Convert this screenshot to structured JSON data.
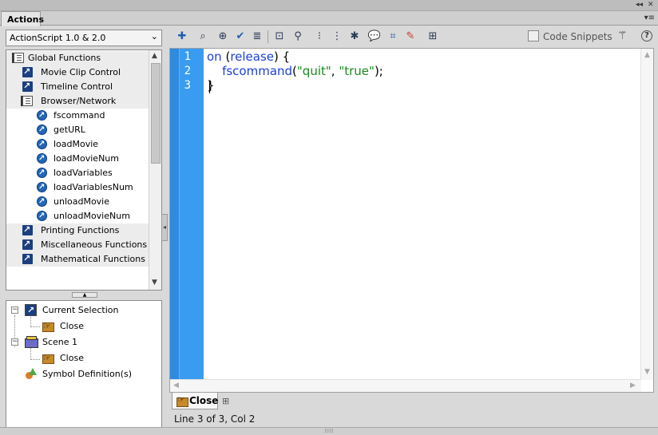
{
  "panel": {
    "tab_label": "Actions",
    "collapse_glyph": "◂◂",
    "close_glyph": "✕",
    "menu_glyph": "▾≡"
  },
  "version_select": {
    "value": "ActionScript 1.0 & 2.0"
  },
  "toolbox": {
    "items": [
      {
        "label": "Global Functions",
        "kind": "book",
        "indent": 0
      },
      {
        "label": "Movie Clip Control",
        "kind": "arrow",
        "indent": 1
      },
      {
        "label": "Timeline Control",
        "kind": "arrow",
        "indent": 1
      },
      {
        "label": "Browser/Network",
        "kind": "book",
        "indent": 1
      },
      {
        "label": "fscommand",
        "kind": "circle",
        "indent": 2
      },
      {
        "label": "getURL",
        "kind": "circle",
        "indent": 2
      },
      {
        "label": "loadMovie",
        "kind": "circle",
        "indent": 2
      },
      {
        "label": "loadMovieNum",
        "kind": "circle",
        "indent": 2
      },
      {
        "label": "loadVariables",
        "kind": "circle",
        "indent": 2
      },
      {
        "label": "loadVariablesNum",
        "kind": "circle",
        "indent": 2
      },
      {
        "label": "unloadMovie",
        "kind": "circle",
        "indent": 2
      },
      {
        "label": "unloadMovieNum",
        "kind": "circle",
        "indent": 2
      },
      {
        "label": "Printing Functions",
        "kind": "arrow",
        "indent": 1
      },
      {
        "label": "Miscellaneous Functions",
        "kind": "arrow",
        "indent": 1
      },
      {
        "label": "Mathematical Functions",
        "kind": "arrow",
        "indent": 1
      }
    ]
  },
  "script_navigator": {
    "current_selection": "Current Selection",
    "current_selection_child": "Close",
    "scene": "Scene 1",
    "scene_child": "Close",
    "symbol_definitions": "Symbol Definition(s)"
  },
  "toolbar": {
    "code_snippets_label": "Code Snippets",
    "help_glyph": "?"
  },
  "editor": {
    "line_numbers": [
      "1",
      "2",
      "3"
    ],
    "lines": [
      [
        {
          "t": "on ",
          "c": "kw"
        },
        {
          "t": "(",
          "c": "plain"
        },
        {
          "t": "release",
          "c": "kw"
        },
        {
          "t": ") {",
          "c": "plain"
        }
      ],
      [
        {
          "t": "    ",
          "c": "plain"
        },
        {
          "t": "fscommand",
          "c": "fn"
        },
        {
          "t": "(",
          "c": "plain"
        },
        {
          "t": "\"quit\"",
          "c": "str"
        },
        {
          "t": ", ",
          "c": "plain"
        },
        {
          "t": "\"true\"",
          "c": "str"
        },
        {
          "t": ");",
          "c": "plain"
        }
      ],
      [
        {
          "t": "}",
          "c": "plain"
        }
      ]
    ]
  },
  "script_tab": {
    "label": "Close"
  },
  "status": {
    "text": "Line 3 of 3, Col 2"
  },
  "colors": {
    "gutter": "#3a9cf0",
    "keyword": "#1c3fd8",
    "string": "#1a8a1a"
  }
}
